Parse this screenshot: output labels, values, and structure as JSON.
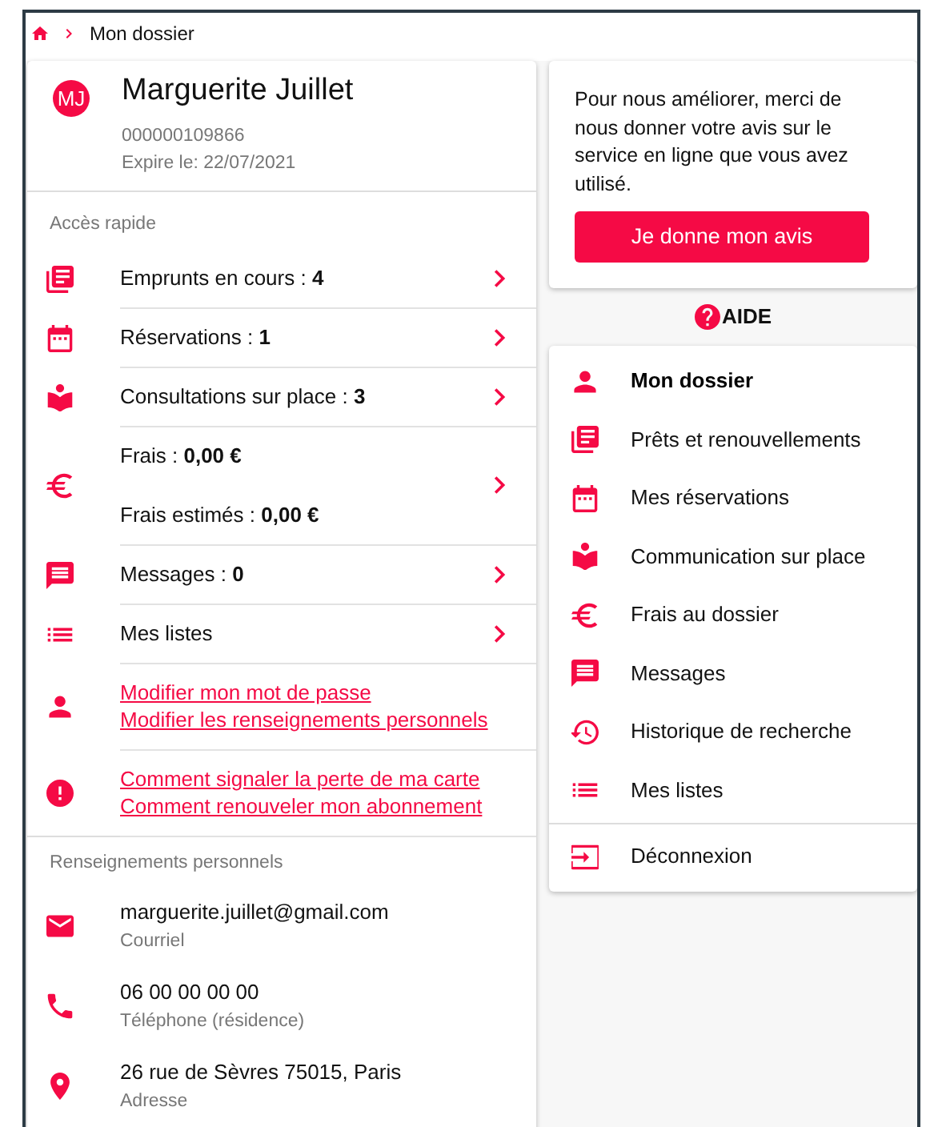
{
  "breadcrumb": {
    "current": "Mon dossier"
  },
  "profile": {
    "initials": "MJ",
    "name": "Marguerite Juillet",
    "card_number": "000000109866",
    "expiry": "Expire le: 22/07/2021"
  },
  "quick_access": {
    "heading": "Accès rapide",
    "items": [
      {
        "kind": "stat",
        "lines": [
          "Emprunts en cours : **4**"
        ]
      },
      {
        "kind": "stat",
        "lines": [
          "Réservations : **1**"
        ]
      },
      {
        "kind": "stat",
        "lines": [
          "Consultations sur place : **3**"
        ]
      },
      {
        "kind": "stat",
        "lines": [
          "Frais : **0,00 €**",
          "Frais estimés : **0,00 €**"
        ]
      },
      {
        "kind": "stat",
        "lines": [
          "Messages : **0**"
        ]
      },
      {
        "kind": "stat",
        "lines": [
          "Mes listes"
        ]
      },
      {
        "kind": "links",
        "lines": [
          "Modifier mon mot de passe",
          "Modifier les renseignements personnels"
        ]
      },
      {
        "kind": "links",
        "lines": [
          "Comment signaler la perte de ma carte",
          "Comment renouveler mon abonnement"
        ]
      }
    ]
  },
  "personal_info": {
    "heading": "Renseignements personnels",
    "items": [
      {
        "value": "marguerite.juillet@gmail.com",
        "label": "Courriel"
      },
      {
        "value": "06 00 00 00 00",
        "label": "Téléphone (résidence)"
      },
      {
        "value": "26 rue de Sèvres 75015, Paris",
        "label": "Adresse"
      }
    ]
  },
  "feedback": {
    "text": "Pour nous améliorer, merci de nous donner votre avis sur le service en ligne que vous avez utilisé.",
    "button": "Je donne mon avis"
  },
  "help": {
    "label": "AIDE"
  },
  "menu": {
    "items": [
      {
        "label": "Mon dossier",
        "selected": true
      },
      {
        "label": "Prêts et renouvellements",
        "selected": false
      },
      {
        "label": "Mes réservations",
        "selected": false
      },
      {
        "label": "Communication sur place",
        "selected": false
      },
      {
        "label": "Frais au dossier",
        "selected": false
      },
      {
        "label": "Messages",
        "selected": false
      },
      {
        "label": "Historique de recherche",
        "selected": false
      },
      {
        "label": "Mes listes",
        "selected": false
      }
    ],
    "logout": "Déconnexion"
  }
}
